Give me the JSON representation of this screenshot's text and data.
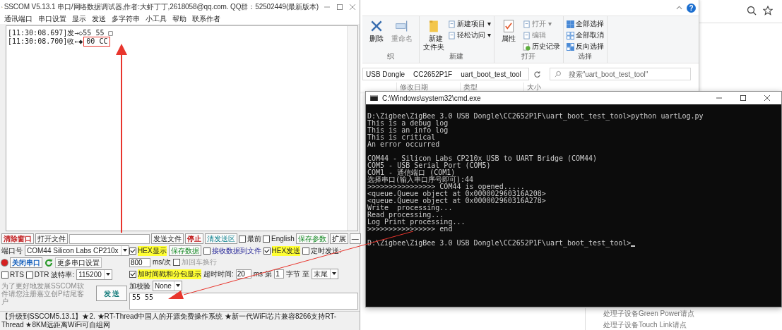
{
  "sscom": {
    "title": "SSCOM V5.13.1 串口/网络数据调试器,作者:大虾丁丁,2618058@qq.com. QQ群：52502449(最新版本)",
    "menu": [
      "通讯端口",
      "串口设置",
      "显示",
      "发送",
      "多字符串",
      "小工具",
      "帮助",
      "联系作者"
    ],
    "receive_lines": [
      {
        "text": "[11:30:08.697]发→◇55 55 □"
      },
      {
        "text": "[11:30:08.700]收←◆",
        "highlight": "00 CC"
      }
    ],
    "clear_button": "清除窗口",
    "open_file_button": "打开文件",
    "send_file_button": "发送文件",
    "stop_button": "停止",
    "clear_send_button": "清发送区",
    "top_checks": [
      {
        "label": "最前",
        "checked": false
      },
      {
        "label": "English",
        "checked": false
      }
    ],
    "save_params_button": "保存参数",
    "expand_button": "扩展",
    "collapse_button": "—",
    "port_label": "端口号",
    "port_value": "COM44 Silicon Labs CP210x",
    "close_port_button": "关闭串口",
    "port_open": true,
    "more_settings_button": "更多串口设置",
    "line_checks": [
      {
        "label": "RTS",
        "checked": false
      },
      {
        "label": "DTR",
        "checked": false
      }
    ],
    "baud_label": "波特率:",
    "baud_value": "115200",
    "hex_display": {
      "label": "HEX显示",
      "checked": true
    },
    "save_data_button": "保存数据",
    "recv_to_file": {
      "label": "接收数据到文件",
      "checked": false
    },
    "hex_send": {
      "label": "HEX发送",
      "checked": true
    },
    "timed_send": {
      "label": "定时发送:",
      "checked": false
    },
    "interval": "800",
    "interval_unit": "ms/次",
    "add_crlf": {
      "label": "加回车换行",
      "checked": false,
      "disabled": true
    },
    "timestamp": {
      "label": "加时间戳和分包显示",
      "checked": true
    },
    "timeout_label": "超时时间:",
    "timeout": "20",
    "timeout_unit": "ms",
    "byte_prefix": "第",
    "byte_from": "1",
    "byte_to_label": "字节 至",
    "byte_to": "末尾",
    "checksum_label": "加校验",
    "checksum": "None",
    "send_text": "55 55",
    "notice": "为了更好地发展SSCOM软件请您注册嘉立创P结尾客户",
    "send_button": "发 送",
    "status": "【升级到SSCOM5.13.1】★2. ★RT-Thread中国人的开源免费操作系统 ★新一代WiFi芯片兼容8266支持RT-Thread ★8KM远距离WiFi可自组网"
  },
  "explorer": {
    "help_button": "?",
    "groups": [
      {
        "label": "织",
        "items": [
          {
            "label": "删除",
            "kind": "large",
            "disabled": false
          },
          {
            "label": "重命名",
            "kind": "large",
            "disabled": true
          }
        ]
      },
      {
        "label": "新建",
        "items": [
          {
            "label": "新建文件夹",
            "kind": "large",
            "disabled": false
          },
          {
            "label": "新建项目 ▾",
            "kind": "small",
            "disabled": false
          },
          {
            "label": "轻松访问 ▾",
            "kind": "small",
            "disabled": false
          }
        ]
      },
      {
        "label": "打开",
        "items": [
          {
            "label": "属性",
            "kind": "large",
            "disabled": false
          },
          {
            "label": "打开 ▾",
            "kind": "small",
            "disabled": true
          },
          {
            "label": "编辑",
            "kind": "small",
            "disabled": true
          },
          {
            "label": "历史记录",
            "kind": "small",
            "disabled": false
          }
        ]
      },
      {
        "label": "选择",
        "items": [
          {
            "label": "全部选择",
            "kind": "small",
            "disabled": false
          },
          {
            "label": "全部取消",
            "kind": "small",
            "disabled": false
          },
          {
            "label": "反向选择",
            "kind": "small",
            "disabled": false
          }
        ]
      }
    ],
    "path": [
      "USB Dongle",
      "CC2652P1F",
      "uart_boot_test_tool"
    ],
    "search_placeholder": "搜索\"uart_boot_test_tool\"",
    "columns": [
      "修改日期",
      "类型",
      "大小"
    ]
  },
  "cmd": {
    "title": "C:\\Windows\\system32\\cmd.exe",
    "blocks": [
      [
        "D:\\Zigbee\\ZigBee 3.0 USB Dongle\\CC2652P1F\\uart_boot_test_tool>python uartLog.py",
        "This is a debug log",
        "This is an info log",
        "This is critical",
        "An error occurred"
      ],
      [
        "COM44 - Silicon Labs CP210x USB to UART Bridge (COM44)",
        "COM5 - USB Serial Port (COM5)",
        "COM1 - 通信端口 (COM1)",
        "选择串口(输入串口序号即可):44",
        ">>>>>>>>>>>>>>>> COM44 is opened.....",
        "<queue.Queue object at 0x000002960316A208>",
        "<queue.Queue object at 0x000002960316A278>",
        "Write  processing...",
        "Read processing...",
        "Log Print processing...",
        ">>>>>>>>>>>>>>>> end"
      ],
      [
        "D:\\Zigbee\\ZigBee 3.0 USB Dongle\\CC2652P1F\\uart_boot_test_tool>"
      ]
    ]
  },
  "background_list": [
    "处理子设备Green Power请点",
    "处理子设备Touch Link请点"
  ]
}
